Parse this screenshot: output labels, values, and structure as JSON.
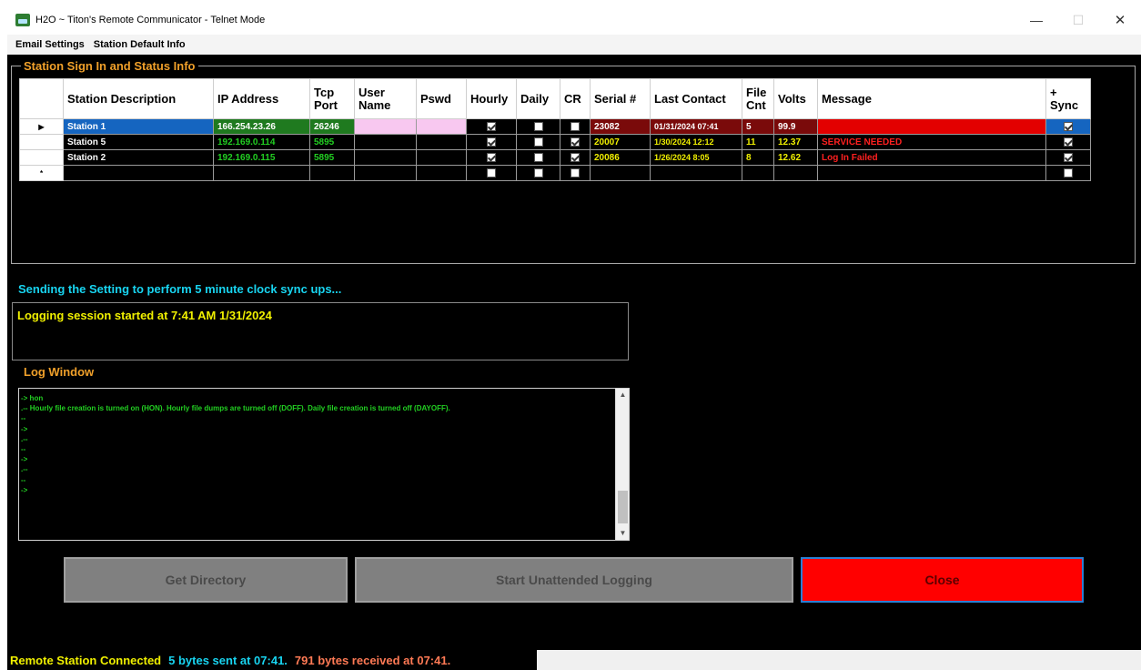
{
  "window": {
    "title": "H2O ~ Titon's Remote Communicator - Telnet Mode",
    "minimize": "—",
    "maximize": "☐",
    "close": "✕"
  },
  "menu": {
    "items": [
      "Email Settings",
      "Station Default Info"
    ]
  },
  "group": {
    "title": "Station Sign In and Status Info"
  },
  "grid": {
    "headers": {
      "desc": "Station Description",
      "ip": "IP Address",
      "port": "Tcp Port",
      "user": "User Name",
      "pswd": "Pswd",
      "hourly": "Hourly",
      "daily": "Daily",
      "cr": "CR",
      "serial": "Serial #",
      "last": "Last Contact",
      "file": "File Cnt",
      "volts": "Volts",
      "message": "Message",
      "sync": "+ Sync"
    },
    "rows": [
      {
        "indicator": "▶",
        "desc": "Station 1",
        "ip": "166.254.23.26",
        "port": "26246",
        "user": "",
        "pswd": "",
        "hourly": true,
        "daily": false,
        "cr": false,
        "serial": "23082",
        "last": "01/31/2024 07:41",
        "file": "5",
        "volts": "99.9",
        "message": "",
        "sync": true
      },
      {
        "indicator": "",
        "desc": "Station 5",
        "ip": "192.169.0.114",
        "port": "5895",
        "user": "",
        "pswd": "",
        "hourly": true,
        "daily": false,
        "cr": true,
        "serial": "20007",
        "last": "1/30/2024 12:12",
        "file": "11",
        "volts": "12.37",
        "message": "SERVICE NEEDED",
        "sync": true
      },
      {
        "indicator": "",
        "desc": "Station 2",
        "ip": "192.169.0.115",
        "port": "5895",
        "user": "",
        "pswd": "",
        "hourly": true,
        "daily": false,
        "cr": true,
        "serial": "20086",
        "last": "1/26/2024 8:05",
        "file": "8",
        "volts": "12.62",
        "message": "Log In Failed",
        "sync": true
      },
      {
        "indicator": "*",
        "desc": "",
        "ip": "",
        "port": "",
        "user": "",
        "pswd": "",
        "hourly": false,
        "daily": false,
        "cr": false,
        "serial": "",
        "last": "",
        "file": "",
        "volts": "",
        "message": "",
        "sync": false
      }
    ]
  },
  "status": {
    "sending": "Sending the Setting to perform 5 minute clock sync ups...",
    "session": "Logging session started at 7:41 AM 1/31/2024"
  },
  "log": {
    "label": "Log Window",
    "lines": [
      "-> hon",
      ".-- Hourly file creation is turned on (HON). Hourly file dumps are turned off (DOFF). Daily file creation is turned off (DAYOFF).",
      "--",
      "->",
      ".--",
      "--",
      "->",
      ".--",
      "--",
      "->"
    ]
  },
  "buttons": {
    "get_directory": "Get Directory",
    "start_logging": "Start Unattended Logging",
    "close": "Close"
  },
  "statusbar": {
    "connected": "Remote Station Connected",
    "sent": "5 bytes sent at 07:41.",
    "received": "791 bytes received at 07:41."
  }
}
